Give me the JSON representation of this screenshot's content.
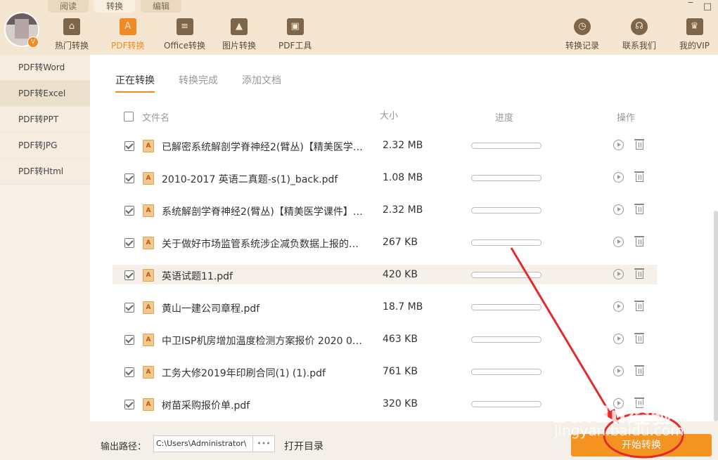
{
  "mode_tabs": [
    "阅读",
    "转换",
    "编辑"
  ],
  "window_controls": [
    "‾",
    "□"
  ],
  "toolbar": {
    "tools": [
      {
        "label": "热门转换",
        "icon": "home-icon"
      },
      {
        "label": "PDF转换",
        "icon": "pdf-icon"
      },
      {
        "label": "Office转换",
        "icon": "document-icon"
      },
      {
        "label": "图片转换",
        "icon": "image-icon"
      },
      {
        "label": "PDF工具",
        "icon": "toolbox-icon"
      }
    ],
    "right_tools": [
      {
        "label": "转换记录",
        "icon": "history-icon"
      },
      {
        "label": "联系我们",
        "icon": "headset-icon"
      },
      {
        "label": "我的VIP",
        "icon": "crown-icon"
      }
    ],
    "vip_badge": "V"
  },
  "sidebar": {
    "items": [
      "PDF转Word",
      "PDF转Excel",
      "PDF转PPT",
      "PDF转JPG",
      "PDF转Html"
    ],
    "active_index": 1
  },
  "tabs": [
    "正在转换",
    "转换完成",
    "添加文档"
  ],
  "table": {
    "headers": {
      "name": "文件名",
      "size": "大小",
      "progress": "进度",
      "ops": "操作"
    },
    "rows": [
      {
        "name": "已解密系统解剖学脊神经2(臂丛)【精美医学…",
        "size": "2.32 MB",
        "progress": 0
      },
      {
        "name": "2010-2017 英语二真题-s(1)_back.pdf",
        "size": "1.08 MB",
        "progress": 0
      },
      {
        "name": "系统解剖学脊神经2(臂丛)【精美医学课件】…",
        "size": "2.32 MB",
        "progress": 0
      },
      {
        "name": "关于做好市场监管系统涉企减负数据上报的…",
        "size": "267 KB",
        "progress": 0
      },
      {
        "name": "英语试题11.pdf",
        "size": "420 KB",
        "progress": 0
      },
      {
        "name": "黄山一建公司章程.pdf",
        "size": "18.7 MB",
        "progress": 0
      },
      {
        "name": "中卫ISP机房增加温度检测方案报价 2020 0…",
        "size": "463 KB",
        "progress": 0
      },
      {
        "name": "工务大修2019年印刷合同(1) (1).pdf",
        "size": "761 KB",
        "progress": 0
      },
      {
        "name": "树苗采购报价单.pdf",
        "size": "320 KB",
        "progress": 0
      }
    ]
  },
  "bottom": {
    "output_label": "输出路径：",
    "output_path": "C:\\Users\\Administrator\\",
    "browse_label": "•••",
    "open_dir_label": "打开目录",
    "start_label": "开始转换"
  },
  "watermark": {
    "line1": "Baidu经验",
    "line2": "jingyan.baidu.com"
  },
  "colors": {
    "accent": "#f08a24",
    "toolbar_bg": "#f4e6d1",
    "annotation": "#e52a2a"
  }
}
